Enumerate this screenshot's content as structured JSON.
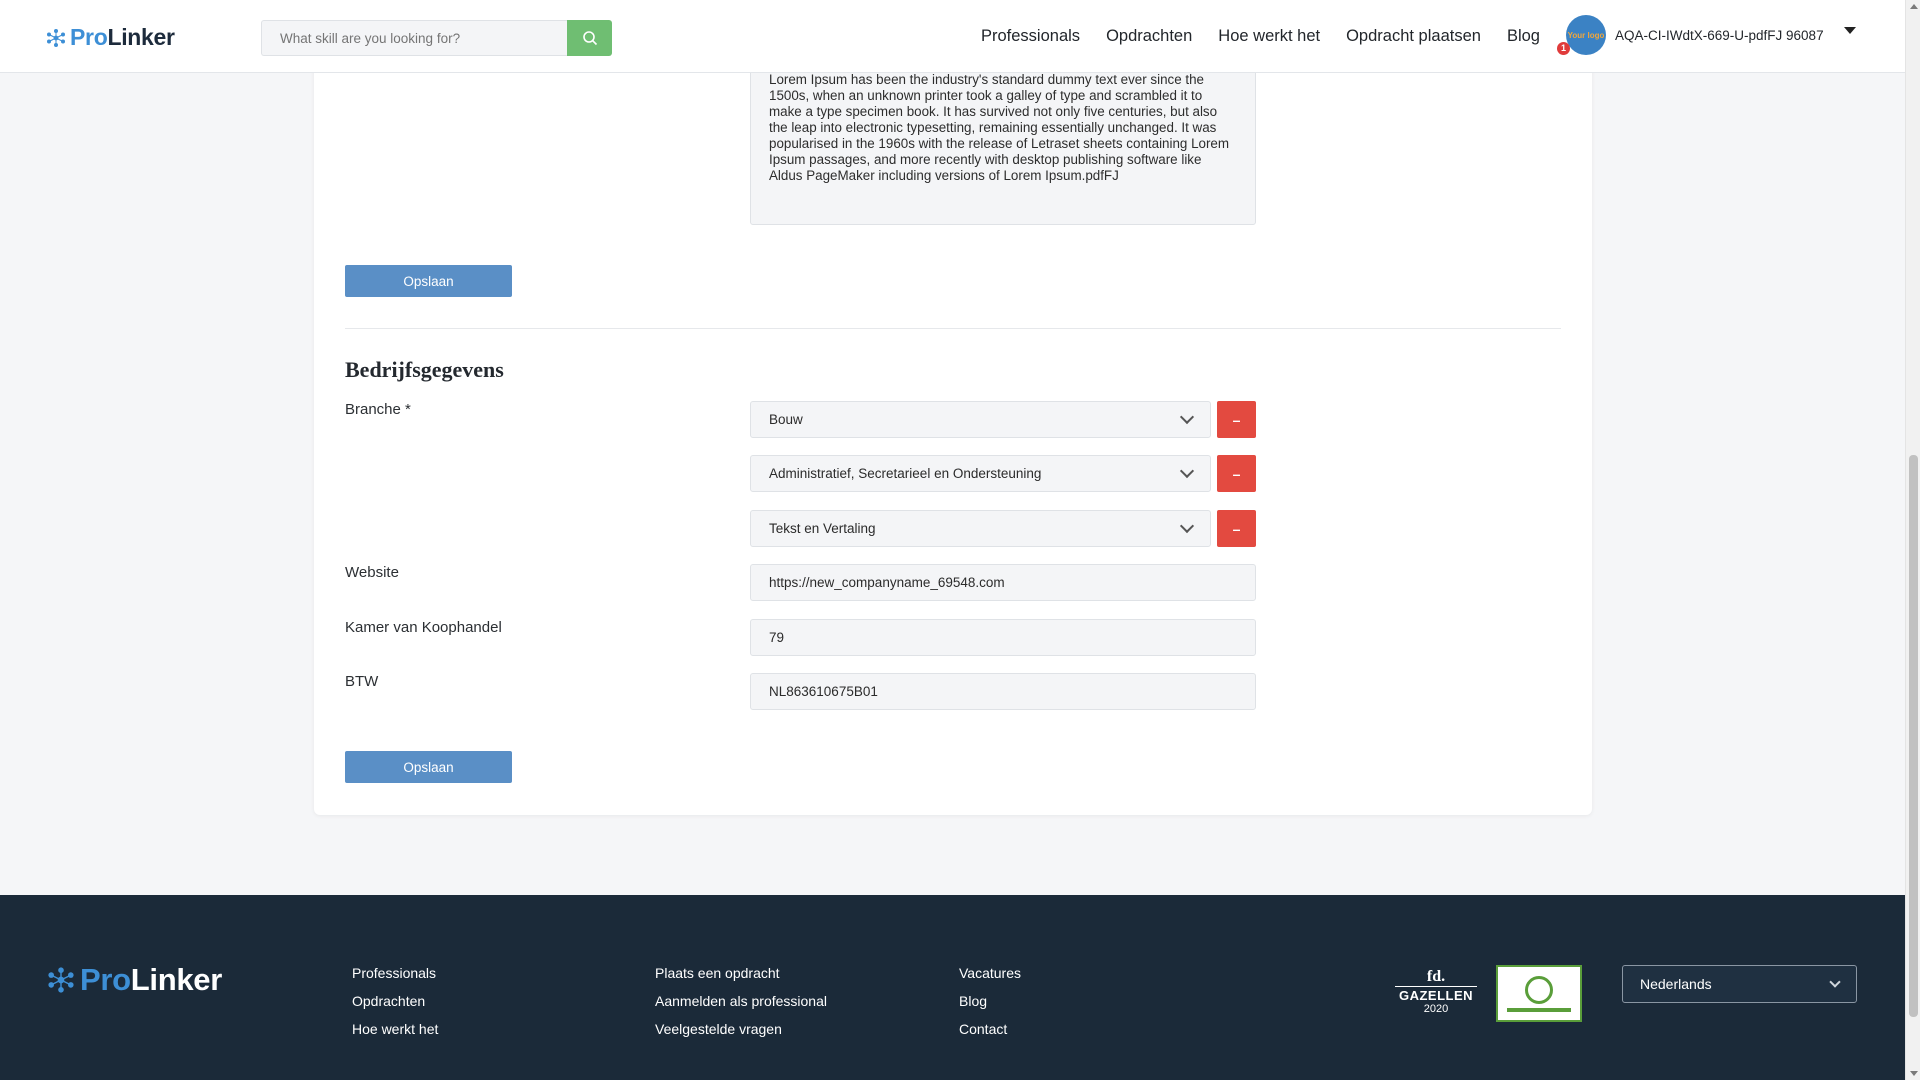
{
  "header": {
    "logo": {
      "pro": "Pro",
      "linker": "Linker"
    },
    "search": {
      "placeholder": "What skill are you looking for?"
    },
    "nav": [
      "Professionals",
      "Opdrachten",
      "Hoe werkt het",
      "Opdracht plaatsen",
      "Blog"
    ],
    "user": {
      "name": "AQA-CI-IWdtX-669-U-pdfFJ 96087",
      "notification_count": "1",
      "avatar_text": "Your logo"
    }
  },
  "profile": {
    "description_text": "Lorem Ipsum has been the industry's standard dummy text ever since the 1500s, when an unknown printer took a galley of type and scrambled it to make a type specimen book. It has survived not only five centuries, but also the leap into electronic typesetting, remaining essentially unchanged. It was popularised in the 1960s with the release of Letraset sheets containing Lorem Ipsum passages, and more recently with desktop publishing software like Aldus PageMaker including versions of Lorem Ipsum.pdfFJ",
    "save_label": "Opslaan"
  },
  "company": {
    "title": "Bedrijfsgegevens",
    "branche_label": "Branche *",
    "branches": [
      "Bouw",
      "Administratief, Secretarieel en Ondersteuning",
      "Tekst en Vertaling"
    ],
    "remove_label": "–",
    "website_label": "Website",
    "website_value": "https://new_companyname_69548.com",
    "kvk_label": "Kamer van Koophandel",
    "kvk_value": "79",
    "btw_label": "BTW",
    "btw_value": "NL863610675B01",
    "save_label": "Opslaan"
  },
  "footer": {
    "logo": {
      "pro": "Pro",
      "linker": "Linker"
    },
    "col1": [
      "Professionals",
      "Opdrachten",
      "Hoe werkt het"
    ],
    "col2": [
      "Plaats een opdracht",
      "Aanmelden als professional",
      "Veelgestelde vragen"
    ],
    "col3": [
      "Vacatures",
      "Blog",
      "Contact"
    ],
    "fd": {
      "top": "fd.",
      "name": "GAZELLEN",
      "year": "2020"
    },
    "language": "Nederlands"
  },
  "colors": {
    "accent": "#3d8fd6",
    "search_button": "#6fbe72",
    "save_button": "#5a8fc6",
    "remove_button": "#e34a40",
    "footer_bg": "#1b2a39"
  }
}
